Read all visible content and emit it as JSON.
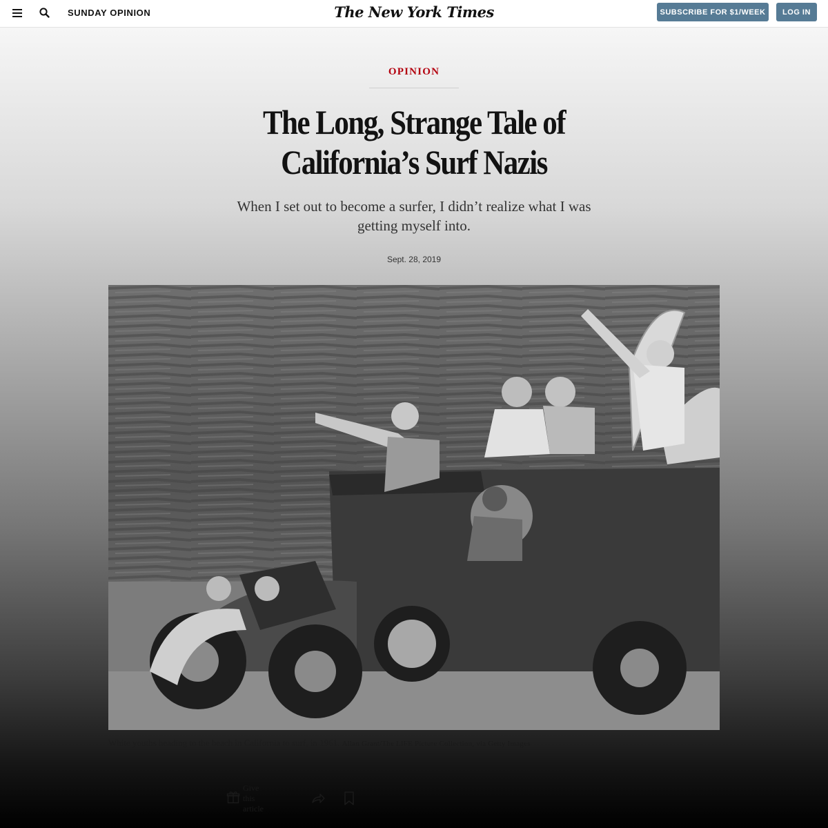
{
  "header": {
    "section_label": "SUNDAY OPINION",
    "masthead": "The New York Times",
    "subscribe_label": "SUBSCRIBE FOR $1/WEEK",
    "login_label": "LOG IN",
    "accent_color": "#567b95"
  },
  "article": {
    "kicker": "OPINION",
    "kicker_color": "#b3000e",
    "headline": "The Long, Strange Tale of California’s Surf Nazis",
    "dek": "When I set out to become a surfer, I didn’t realize what I was getting myself into.",
    "date": "Sept. 28, 2019"
  },
  "photo": {
    "caption": "White youths heading to the beach in California to surf, in 1961.",
    "credit": "Allan Grant/The LIFE Picture Collection, via Getty Images"
  },
  "tools": {
    "gift_label": "Give this article",
    "icons": [
      "menu-icon",
      "search-icon",
      "gift-icon",
      "share-icon",
      "bookmark-icon"
    ]
  }
}
